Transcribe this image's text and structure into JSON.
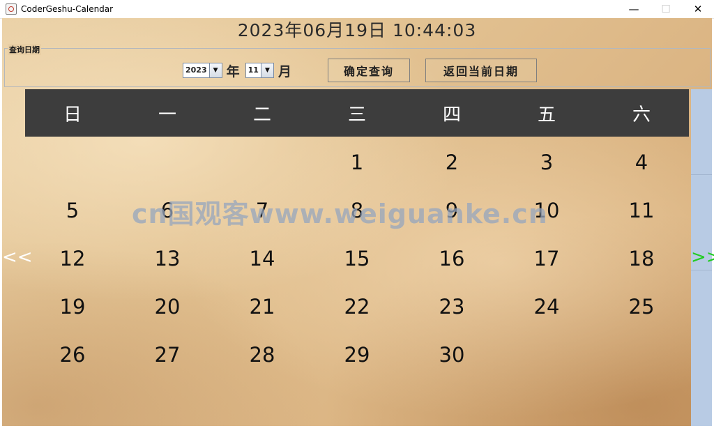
{
  "window": {
    "title": "CoderGeshu-Calendar",
    "minimize_glyph": "—",
    "maximize_glyph": "☐",
    "close_glyph": "✕"
  },
  "clock": "2023年06月19日  10:44:03",
  "query_panel": {
    "legend": "查询日期",
    "year_value": "2023",
    "year_unit": "年",
    "month_value": "11",
    "month_unit": "月",
    "query_button": "确定查询",
    "today_button": "返回当前日期"
  },
  "calendar": {
    "weekdays": [
      "日",
      "一",
      "二",
      "三",
      "四",
      "五",
      "六"
    ],
    "days": [
      "",
      "",
      "",
      "1",
      "2",
      "3",
      "4",
      "5",
      "6",
      "7",
      "8",
      "9",
      "10",
      "11",
      "12",
      "13",
      "14",
      "15",
      "16",
      "17",
      "18",
      "19",
      "20",
      "21",
      "22",
      "23",
      "24",
      "25",
      "26",
      "27",
      "28",
      "29",
      "30",
      "",
      ""
    ],
    "prev_label": "<<",
    "next_label": ">>"
  },
  "watermark": "cn国观客www.weiguanke.cn",
  "colors": {
    "header_bg": "#3d3d3d",
    "next_arrow": "#22cc22",
    "right_strip": "#b8cbe4"
  },
  "icons": {
    "app": "java-cup-icon",
    "dropdown": "chevron-down-icon"
  }
}
